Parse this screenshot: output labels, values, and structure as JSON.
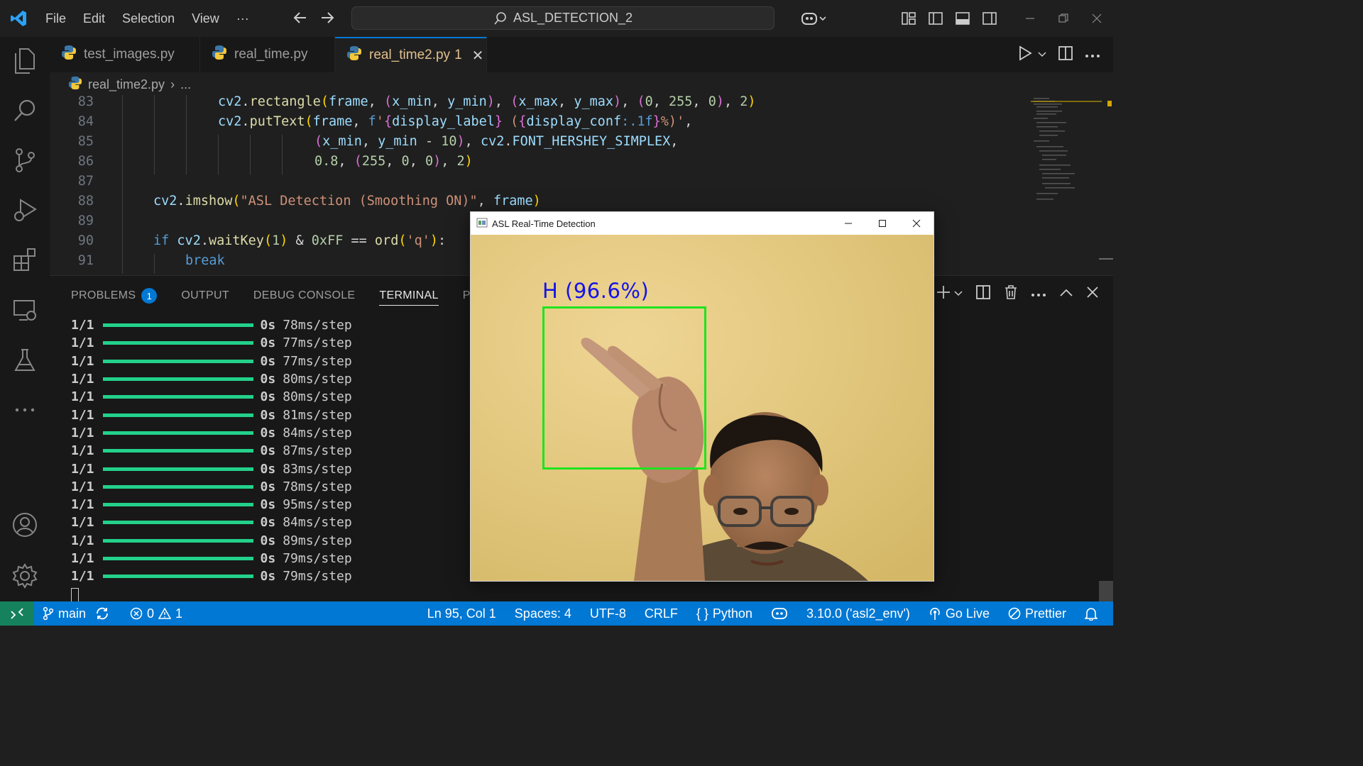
{
  "titlebar": {
    "menu": [
      "File",
      "Edit",
      "Selection",
      "View",
      "···"
    ],
    "search_text": "ASL_DETECTION_2"
  },
  "tabs": [
    {
      "label": "test_images.py",
      "active": false
    },
    {
      "label": "real_time.py",
      "active": false
    },
    {
      "label": "real_time2.py",
      "badge": "1",
      "active": true
    }
  ],
  "breadcrumb": {
    "file": "real_time2.py",
    "rest": "..."
  },
  "editor": {
    "lines": [
      {
        "num": "83"
      },
      {
        "num": "84"
      },
      {
        "num": "85"
      },
      {
        "num": "86"
      },
      {
        "num": "87"
      },
      {
        "num": "88"
      },
      {
        "num": "89"
      },
      {
        "num": "90"
      },
      {
        "num": "91"
      }
    ]
  },
  "panel": {
    "tabs": [
      "PROBLEMS",
      "OUTPUT",
      "DEBUG CONSOLE",
      "TERMINAL",
      "PORTS"
    ],
    "problems_badge": "1",
    "active_tab": "TERMINAL",
    "terminal_lines": [
      {
        "step": "1/1",
        "time": "0s",
        "rate": "78ms/step"
      },
      {
        "step": "1/1",
        "time": "0s",
        "rate": "77ms/step"
      },
      {
        "step": "1/1",
        "time": "0s",
        "rate": "77ms/step"
      },
      {
        "step": "1/1",
        "time": "0s",
        "rate": "80ms/step"
      },
      {
        "step": "1/1",
        "time": "0s",
        "rate": "80ms/step"
      },
      {
        "step": "1/1",
        "time": "0s",
        "rate": "81ms/step"
      },
      {
        "step": "1/1",
        "time": "0s",
        "rate": "84ms/step"
      },
      {
        "step": "1/1",
        "time": "0s",
        "rate": "87ms/step"
      },
      {
        "step": "1/1",
        "time": "0s",
        "rate": "83ms/step"
      },
      {
        "step": "1/1",
        "time": "0s",
        "rate": "78ms/step"
      },
      {
        "step": "1/1",
        "time": "0s",
        "rate": "95ms/step"
      },
      {
        "step": "1/1",
        "time": "0s",
        "rate": "84ms/step"
      },
      {
        "step": "1/1",
        "time": "0s",
        "rate": "89ms/step"
      },
      {
        "step": "1/1",
        "time": "0s",
        "rate": "79ms/step"
      },
      {
        "step": "1/1",
        "time": "0s",
        "rate": "79ms/step"
      }
    ]
  },
  "statusbar": {
    "branch": "main",
    "errors": "0",
    "warnings": "1",
    "position": "Ln 95, Col 1",
    "spaces": "Spaces: 4",
    "encoding": "UTF-8",
    "eol": "CRLF",
    "language": "Python",
    "interpreter": "3.10.0 ('asl2_env')",
    "golive": "Go Live",
    "prettier": "Prettier"
  },
  "cv_window": {
    "title": "ASL Real-Time Detection",
    "detection_label": "H (96.6%)"
  },
  "colors": {
    "accent": "#0078d4",
    "status_bar": "#0078d4",
    "remote": "#16825d",
    "progress": "#23d18b",
    "detect_box": "#1ee41e",
    "detect_label": "#1414e6"
  }
}
